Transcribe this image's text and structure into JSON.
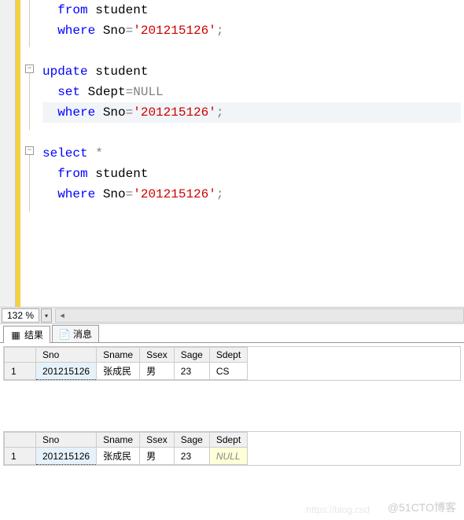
{
  "code": {
    "line1_pre": "  ",
    "line1_kw": "from",
    "line1_rest": " student",
    "line2_pre": "  ",
    "line2_kw": "where",
    "line2_mid": " Sno",
    "line2_op": "=",
    "line2_str": "'201215126'",
    "line2_end": ";",
    "line4_kw": "update",
    "line4_rest": " student",
    "line5_pre": "  ",
    "line5_kw": "set",
    "line5_mid": " Sdept",
    "line5_op": "=",
    "line5_null": "NULL",
    "line6_pre": "  ",
    "line6_kw": "where",
    "line6_mid": " Sno",
    "line6_op": "=",
    "line6_str": "'201215126'",
    "line6_end": ";",
    "line8_kw": "select",
    "line8_op": " *",
    "line9_pre": "  ",
    "line9_kw": "from",
    "line9_rest": " student",
    "line10_pre": "  ",
    "line10_kw": "where",
    "line10_mid": " Sno",
    "line10_op": "=",
    "line10_str": "'201215126'",
    "line10_end": ";"
  },
  "zoom": {
    "value": "132 %",
    "dd_icon": "▾"
  },
  "tabs": {
    "results": "结果",
    "messages": "消息"
  },
  "grid": {
    "headers": {
      "sno": "Sno",
      "sname": "Sname",
      "ssex": "Ssex",
      "sage": "Sage",
      "sdept": "Sdept"
    },
    "row1": {
      "num": "1",
      "sno": "201215126",
      "sname": "张成民",
      "ssex": "男",
      "sage": "23",
      "sdept": "CS"
    },
    "row2": {
      "num": "1",
      "sno": "201215126",
      "sname": "张成民",
      "ssex": "男",
      "sage": "23",
      "sdept": "NULL"
    }
  },
  "watermark": "@51CTO博客",
  "watermark2": "https://blog.csd"
}
